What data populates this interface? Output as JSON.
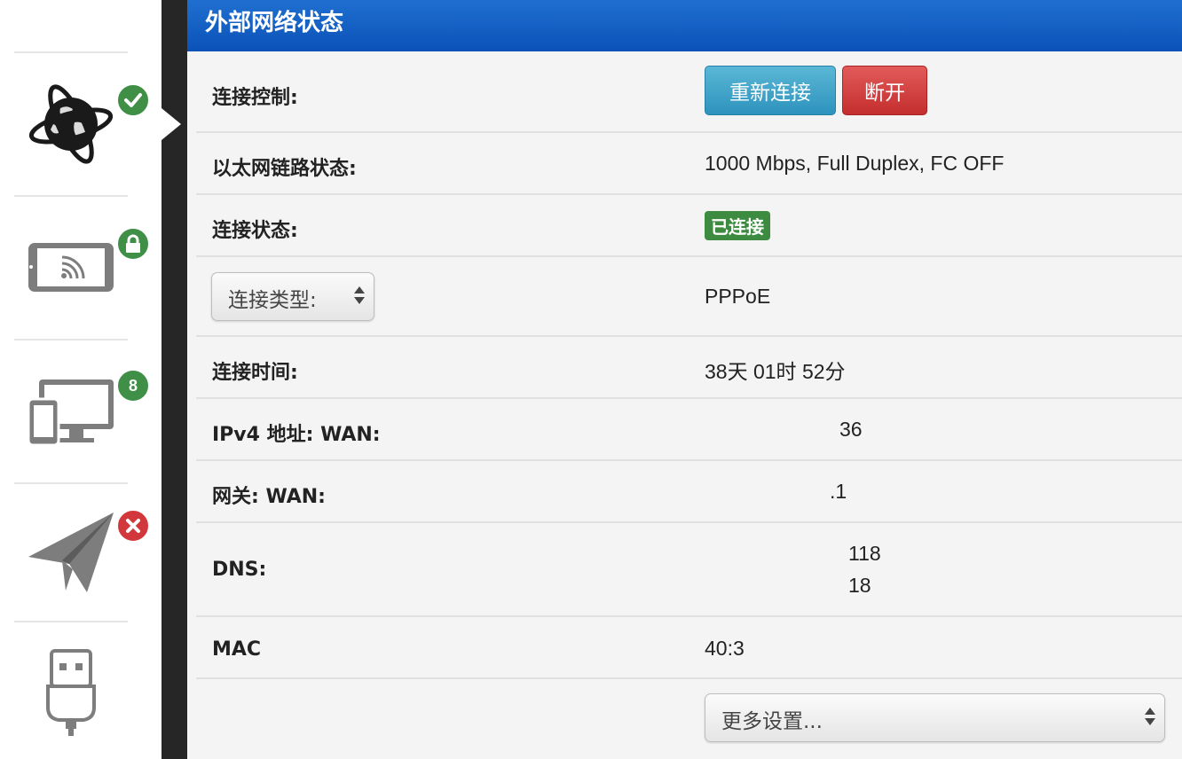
{
  "sidebar": {
    "items": [
      {
        "name": "internet",
        "icon": "globe-icon",
        "badge_icon": "check-icon",
        "badge_color": "#3f8f46"
      },
      {
        "name": "wireless",
        "icon": "tablet-wifi-icon",
        "badge_icon": "lock-icon",
        "badge_color": "#3f8f46"
      },
      {
        "name": "devices",
        "icon": "devices-icon",
        "badge_text": "8",
        "badge_color": "#3f8f46"
      },
      {
        "name": "remote",
        "icon": "paper-plane-icon",
        "badge_icon": "x-icon",
        "badge_color": "#d2383b"
      },
      {
        "name": "usb",
        "icon": "usb-icon"
      }
    ]
  },
  "panel": {
    "title": "外部网络状态",
    "rows": {
      "control": {
        "label": "连接控制:",
        "reconnect": "重新连接",
        "disconnect": "断开"
      },
      "link": {
        "label": "以太网链路状态:",
        "value": "1000 Mbps, Full Duplex, FC OFF"
      },
      "status": {
        "label": "连接状态:",
        "value": "已连接"
      },
      "type": {
        "select_label": "连接类型:",
        "value": "PPPoE"
      },
      "uptime": {
        "label": "连接时间:",
        "value": "38天 01时 52分"
      },
      "ipv4": {
        "label": "IPv4 地址: WAN:",
        "value": "36"
      },
      "gateway": {
        "label": "网关: WAN:",
        "value": ".1"
      },
      "dns": {
        "label": "DNS:",
        "value1": "118",
        "value2": "18"
      },
      "mac": {
        "label": "MAC",
        "value": "40:3"
      },
      "more": {
        "select_label": "更多设置..."
      }
    }
  },
  "colors": {
    "header_blue": "#0b52b8",
    "reconnect_button": "#2d93bd",
    "disconnect_button": "#c42e2e",
    "connected_badge": "#3d8b40"
  }
}
